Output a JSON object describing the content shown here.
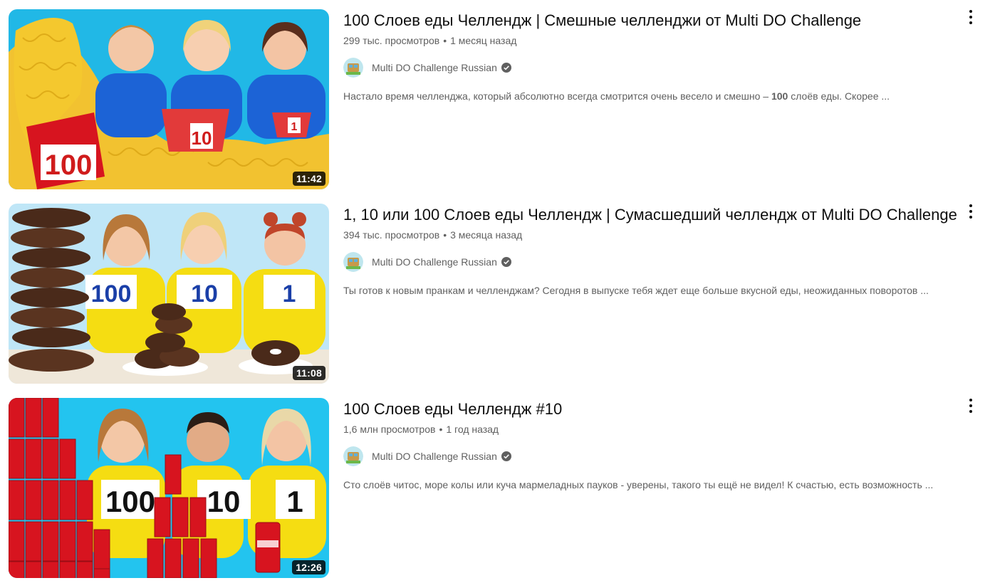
{
  "videos": [
    {
      "title": "100 Слоев еды Челлендж | Смешные челленджи от Multi DO Challenge",
      "views": "299 тыс. просмотров",
      "age": "1 месяц назад",
      "channel": "Multi DO Challenge Russian",
      "description_pre": "Настало время челленджа, который абсолютно всегда смотрится очень весело и смешно – ",
      "description_bold": "100",
      "description_post": " слоёв еды. Скорее ...",
      "duration": "11:42",
      "thumb_labels": [
        "100",
        "10",
        "1"
      ]
    },
    {
      "title": "1, 10 или 100 Слоев еды Челлендж | Сумасшедший челлендж от Multi DO Challenge",
      "views": "394 тыс. просмотров",
      "age": "3 месяца назад",
      "channel": "Multi DO Challenge Russian",
      "description_pre": "Ты готов к новым пранкам и челленджам? Сегодня в выпуске тебя ждет еще больше вкусной еды, неожиданных поворотов ...",
      "description_bold": "",
      "description_post": "",
      "duration": "11:08",
      "thumb_labels": [
        "100",
        "10",
        "1"
      ]
    },
    {
      "title": "100 Слоев еды Челлендж #10",
      "views": "1,6 млн просмотров",
      "age": "1 год назад",
      "channel": "Multi DO Challenge Russian",
      "description_pre": "Сто слоёв читос, море колы или куча мармеладных пауков - уверены, такого ты ещё не видел! К счастью, есть возможность ...",
      "description_bold": "",
      "description_post": "",
      "duration": "12:26",
      "thumb_labels": [
        "100",
        "10",
        "1"
      ]
    }
  ],
  "colors": {
    "title": "#0f0f0f",
    "meta": "#606060",
    "thumb1_bg": "#21b8e6",
    "thumb2_bg": "#bfe6f7",
    "thumb3_bg": "#23c4ef",
    "noodles": "#f2c230",
    "shirt_blue": "#1c63d6",
    "shirt_yellow": "#f5dd12",
    "coke_red": "#d7141f"
  },
  "icons": {
    "menu": "more-vert-icon",
    "verified": "verified-check-icon"
  }
}
